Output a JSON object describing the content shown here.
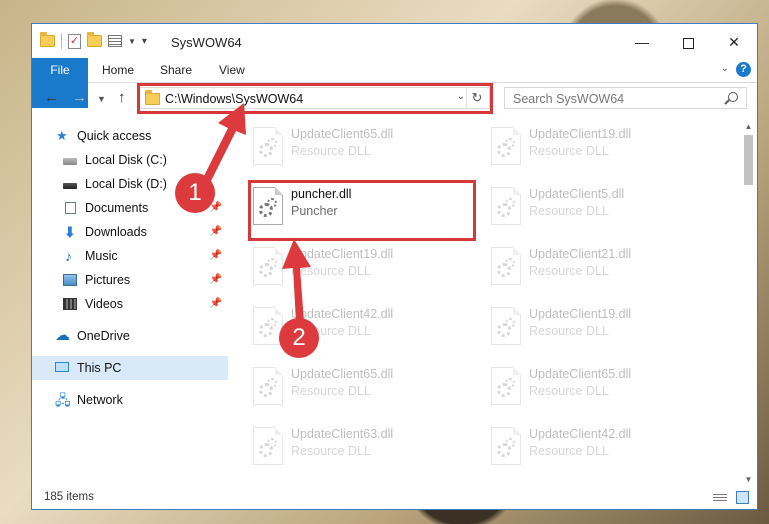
{
  "window": {
    "title": "SysWOW64",
    "controls": {
      "minimize": "—",
      "close": "✕"
    }
  },
  "ribbon": {
    "tabs": [
      "File",
      "Home",
      "Share",
      "View"
    ],
    "help": "?"
  },
  "navigation": {
    "address": "C:\\Windows\\SysWOW64",
    "search_placeholder": "Search SysWOW64"
  },
  "sidebar": {
    "items": [
      {
        "label": "Quick access",
        "icon": "star-icon"
      },
      {
        "label": "Local Disk (C:)",
        "icon": "drive-icon"
      },
      {
        "label": "Local Disk (D:)",
        "icon": "drive-icon"
      },
      {
        "label": "Documents",
        "icon": "documents-icon",
        "pinned": true
      },
      {
        "label": "Downloads",
        "icon": "download-icon",
        "pinned": true
      },
      {
        "label": "Music",
        "icon": "music-icon",
        "pinned": true
      },
      {
        "label": "Pictures",
        "icon": "pictures-icon",
        "pinned": true
      },
      {
        "label": "Videos",
        "icon": "videos-icon",
        "pinned": true
      },
      {
        "label": "OneDrive",
        "icon": "cloud-icon"
      },
      {
        "label": "This PC",
        "icon": "pc-icon",
        "selected": true
      },
      {
        "label": "Network",
        "icon": "network-icon"
      }
    ]
  },
  "files": [
    {
      "name": "UpdateClient65.dll",
      "desc": "Resource DLL"
    },
    {
      "name": "UpdateClient19.dll",
      "desc": "Resource DLL"
    },
    {
      "name": "puncher.dll",
      "desc": "Puncher",
      "highlighted": true
    },
    {
      "name": "UpdateClient5.dll",
      "desc": "Resource DLL"
    },
    {
      "name": "UpdateClient19.dll",
      "desc": "Resource DLL"
    },
    {
      "name": "UpdateClient21.dll",
      "desc": "Resource DLL"
    },
    {
      "name": "UpdateClient42.dll",
      "desc": "Resource DLL"
    },
    {
      "name": "UpdateClient19.dll",
      "desc": "Resource DLL"
    },
    {
      "name": "UpdateClient65.dll",
      "desc": "Resource DLL"
    },
    {
      "name": "UpdateClient65.dll",
      "desc": "Resource DLL"
    },
    {
      "name": "UpdateClient63.dll",
      "desc": "Resource DLL"
    },
    {
      "name": "UpdateClient42.dll",
      "desc": "Resource DLL"
    }
  ],
  "status": {
    "item_count": "185 items"
  },
  "annotations": {
    "step1": "1",
    "step2": "2",
    "color": "#dc3a3c"
  }
}
